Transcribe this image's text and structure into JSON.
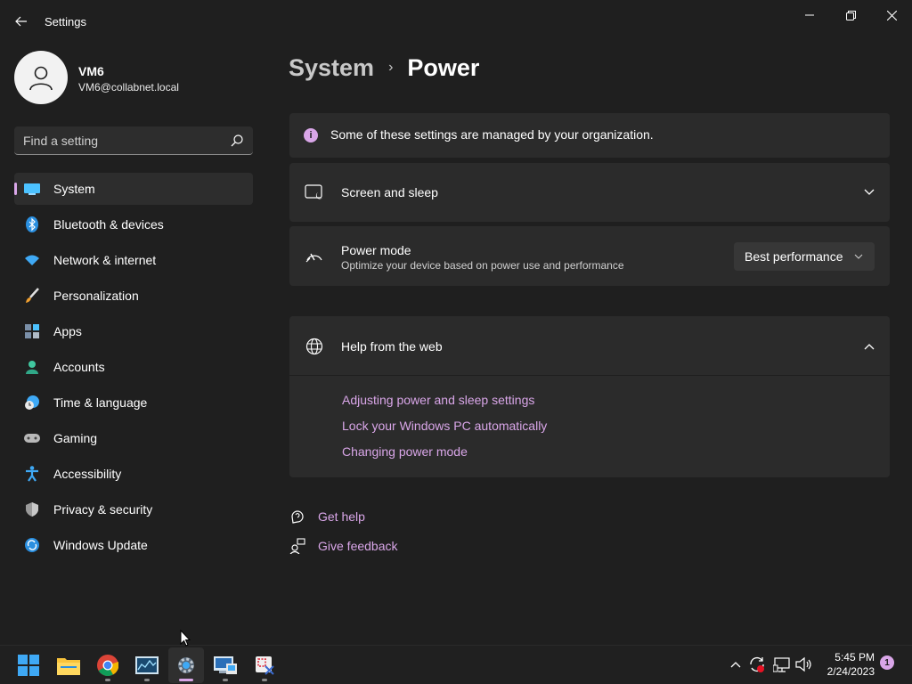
{
  "app": {
    "title": "Settings"
  },
  "profile": {
    "name": "VM6",
    "email": "VM6@collabnet.local"
  },
  "search": {
    "placeholder": "Find a setting"
  },
  "sidebar": {
    "items": [
      {
        "label": "System",
        "icon": "system-icon",
        "active": true
      },
      {
        "label": "Bluetooth & devices",
        "icon": "bluetooth-icon"
      },
      {
        "label": "Network & internet",
        "icon": "wifi-icon"
      },
      {
        "label": "Personalization",
        "icon": "brush-icon"
      },
      {
        "label": "Apps",
        "icon": "apps-icon"
      },
      {
        "label": "Accounts",
        "icon": "accounts-icon"
      },
      {
        "label": "Time & language",
        "icon": "clock-globe-icon"
      },
      {
        "label": "Gaming",
        "icon": "gamepad-icon"
      },
      {
        "label": "Accessibility",
        "icon": "accessibility-icon"
      },
      {
        "label": "Privacy & security",
        "icon": "shield-icon"
      },
      {
        "label": "Windows Update",
        "icon": "update-icon"
      }
    ]
  },
  "breadcrumb": {
    "parent": "System",
    "separator": "›",
    "current": "Power"
  },
  "info": {
    "text": "Some of these settings are managed by your organization."
  },
  "screen_sleep": {
    "title": "Screen and sleep"
  },
  "power_mode": {
    "title": "Power mode",
    "subtitle": "Optimize your device based on power use and performance",
    "value": "Best performance"
  },
  "help": {
    "title": "Help from the web",
    "links": [
      "Adjusting power and sleep settings",
      "Lock your Windows PC automatically",
      "Changing power mode"
    ]
  },
  "footer": {
    "get_help": "Get help",
    "give_feedback": "Give feedback"
  },
  "taskbar": {
    "apps": [
      "start-icon",
      "file-explorer-icon",
      "chrome-icon",
      "resource-monitor-icon",
      "settings-icon",
      "remote-desktop-icon",
      "snipping-tool-icon"
    ],
    "time": "5:45 PM",
    "date": "2/24/2023",
    "notifications": "1"
  },
  "colors": {
    "accent": "#d9a6e8",
    "background": "#1f1f1f",
    "card": "#2b2b2b"
  }
}
